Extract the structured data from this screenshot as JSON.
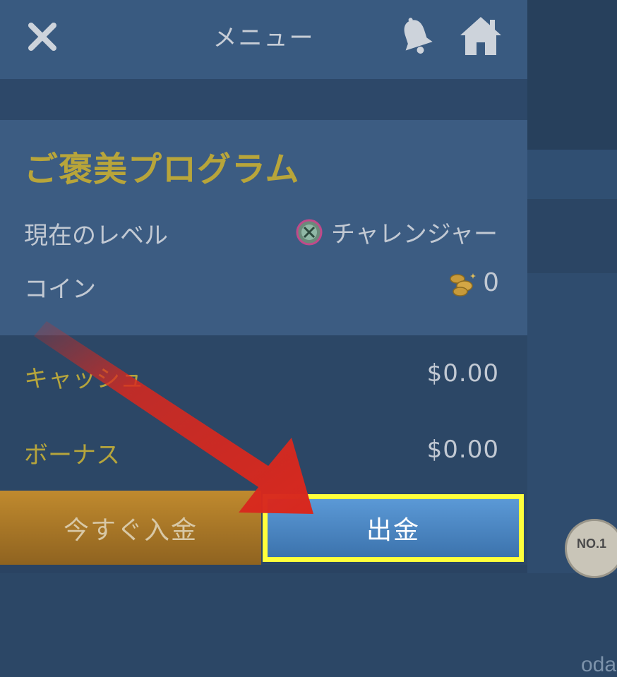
{
  "menu": {
    "title": "メニュー",
    "icons": {
      "close": "close-icon",
      "bell": "bell-icon",
      "home": "home-icon"
    }
  },
  "rewards": {
    "title": "ご褒美プログラム",
    "level_label": "現在のレベル",
    "level_value": "チャレンジャー",
    "coin_label": "コイン",
    "coin_value": "0"
  },
  "balances": {
    "cash_label": "キャッシュ",
    "cash_value": "$0.00",
    "bonus_label": "ボーナス",
    "bonus_value": "$0.00"
  },
  "buttons": {
    "deposit_label": "今すぐ入金",
    "withdraw_label": "出金"
  },
  "background": {
    "partial_text": "oda",
    "badge_text": "NO.1"
  },
  "colors": {
    "accent_gold": "#b8a53a",
    "withdraw_blue": "#4a86c4",
    "highlight_yellow": "#ffff3c",
    "arrow_red": "#d8281e"
  }
}
